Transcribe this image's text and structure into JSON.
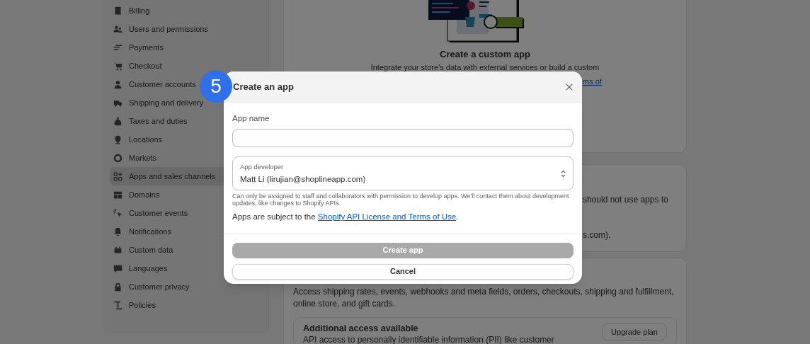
{
  "sidebar": {
    "items": [
      {
        "label": "Billing",
        "selected": false
      },
      {
        "label": "Users and permissions",
        "selected": false
      },
      {
        "label": "Payments",
        "selected": false
      },
      {
        "label": "Checkout",
        "selected": false
      },
      {
        "label": "Customer accounts",
        "selected": false
      },
      {
        "label": "Shipping and delivery",
        "selected": false
      },
      {
        "label": "Taxes and duties",
        "selected": false
      },
      {
        "label": "Locations",
        "selected": false
      },
      {
        "label": "Markets",
        "selected": false
      },
      {
        "label": "Apps and sales channels",
        "selected": true
      },
      {
        "label": "Domains",
        "selected": false
      },
      {
        "label": "Customer events",
        "selected": false
      },
      {
        "label": "Notifications",
        "selected": false
      },
      {
        "label": "Custom data",
        "selected": false
      },
      {
        "label": "Languages",
        "selected": false
      },
      {
        "label": "Customer privacy",
        "selected": false
      },
      {
        "label": "Policies",
        "selected": false
      }
    ]
  },
  "main": {
    "custom_app_card": {
      "title": "Create a custom app",
      "description": "Integrate your store’s data with external services or build a custom",
      "link_fragment": "ms of"
    },
    "notice_card": {
      "line_1": "should not use apps to",
      "line_2": "s.com)."
    },
    "access_card": {
      "description": "Access shipping rates, events, webhooks and meta fields, orders, checkouts, shipping and fulfillment, online store, and gift cards.",
      "additional_access": {
        "title": "Additional access available",
        "text": "API access to personally identifiable information (PII) like customer",
        "button": "Upgrade plan"
      }
    }
  },
  "modal": {
    "step_badge": "5",
    "title": "Create an app",
    "app_name": {
      "label": "App name"
    },
    "app_developer": {
      "label": "App developer",
      "value": "Matt Li (lirujian@shoplineapp.com)",
      "help": "Can only be assigned to staff and collaborators with permission to develop apps. We’ll contact them about development updates, like changes to Shopify APIs."
    },
    "terms": {
      "text": "Apps are subject to the ",
      "link": "Shopify API License and Terms of Use",
      "end": "."
    },
    "buttons": [
      {
        "label": "Create app",
        "kind": "primary",
        "disabled": true
      },
      {
        "label": "Cancel",
        "kind": "secondary",
        "disabled": false
      }
    ]
  }
}
